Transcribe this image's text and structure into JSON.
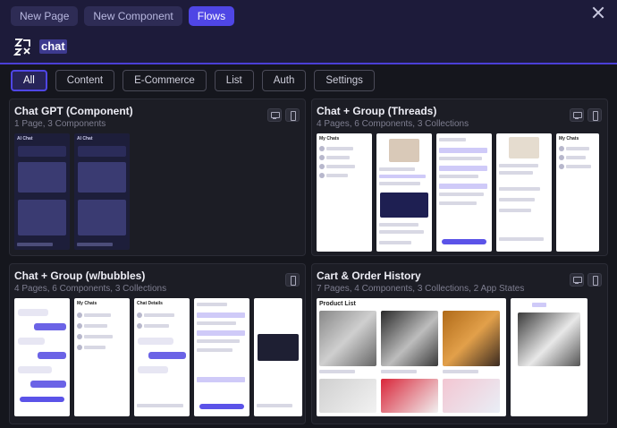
{
  "header": {
    "tabs": [
      {
        "label": "New Page",
        "active": false
      },
      {
        "label": "New Component",
        "active": false
      },
      {
        "label": "Flows",
        "active": true
      }
    ],
    "search": {
      "value": "chat",
      "icon": "app-logo-icon"
    },
    "close_icon": "close-icon"
  },
  "filters": [
    {
      "label": "All",
      "active": true
    },
    {
      "label": "Content",
      "active": false
    },
    {
      "label": "E-Commerce",
      "active": false
    },
    {
      "label": "List",
      "active": false
    },
    {
      "label": "Auth",
      "active": false
    },
    {
      "label": "Settings",
      "active": false
    }
  ],
  "cards": [
    {
      "title": "Chat GPT (Component)",
      "subtitle": "1 Page, 3 Components",
      "devices": [
        "desktop-icon",
        "mobile-icon"
      ]
    },
    {
      "title": "Chat + Group (Threads)",
      "subtitle": "4 Pages, 6 Components, 3 Collections",
      "devices": [
        "desktop-icon",
        "mobile-icon"
      ]
    },
    {
      "title": "Chat + Group (w/bubbles)",
      "subtitle": "4 Pages, 6 Components, 3 Collections",
      "devices": [
        "mobile-icon"
      ]
    },
    {
      "title": "Cart & Order History",
      "subtitle": "7 Pages, 4 Components, 3 Collections, 2 App States",
      "devices": [
        "desktop-icon",
        "mobile-icon"
      ]
    }
  ],
  "previews": {
    "gpt_header": "AI Chat",
    "threads_header": "My Chats",
    "bubbles_header": "My Chats",
    "chat_details": "Chat Details",
    "product_list": "Product List"
  },
  "colors": {
    "accent": "#4f46e5",
    "header_bg": "#1d1b3a",
    "page_bg": "#15161d"
  }
}
